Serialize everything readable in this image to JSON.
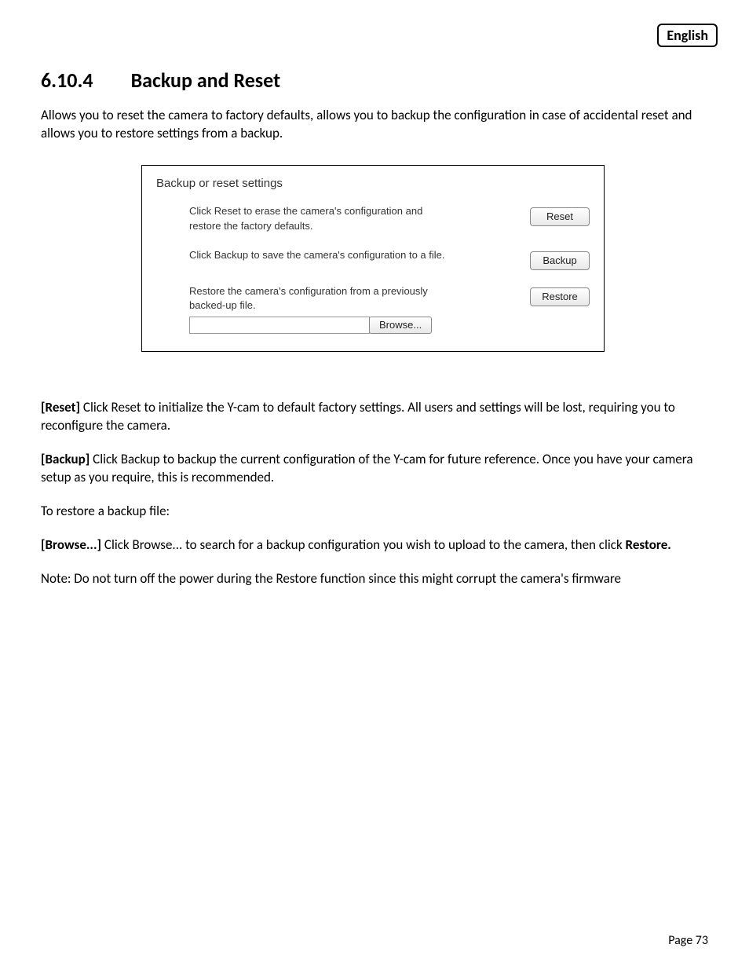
{
  "language_badge": "English",
  "heading": {
    "number": "6.10.4",
    "title": "Backup and Reset"
  },
  "intro": "Allows you to reset the camera to factory defaults, allows you to backup the configuration in case of accidental reset and allows you to restore settings from a backup.",
  "panel": {
    "title": "Backup or reset settings",
    "reset": {
      "text": "Click Reset to erase the camera's configuration and restore the factory defaults.",
      "button": "Reset"
    },
    "backup": {
      "text": "Click Backup to save the camera's configuration to a file.",
      "button": "Backup"
    },
    "restore": {
      "text": "Restore the camera's configuration from a previously backed-up file.",
      "browse_button": "Browse...",
      "button": "Restore",
      "file_value": ""
    }
  },
  "desc": {
    "reset_label": "[Reset]",
    "reset_text": " Click Reset to initialize the Y-cam to default factory settings. All users and settings will be lost, requiring you to reconfigure the camera.",
    "backup_label": "[Backup]",
    "backup_text": " Click Backup to backup the current configuration of the Y-cam for future reference. Once you have your camera setup as you require, this is recommended.",
    "restore_intro": "To restore a backup file:",
    "browse_label": "[Browse...]",
    "browse_text": " Click Browse... to search for a backup configuration you wish to upload to the camera, then click ",
    "browse_tail_bold": "Restore.",
    "note": "Note: Do not turn off the power during the Restore function since this might corrupt the camera's firmware"
  },
  "footer": {
    "page_label": "Page 73"
  }
}
